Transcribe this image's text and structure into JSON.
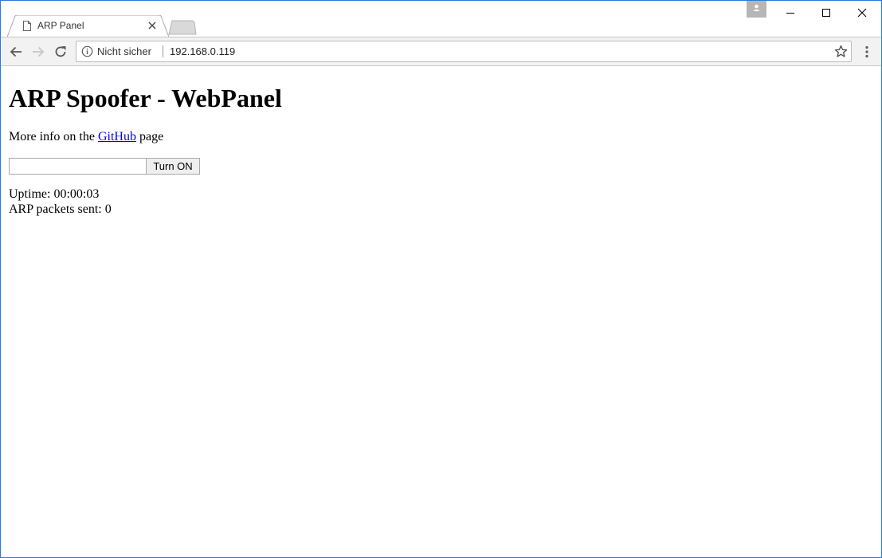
{
  "browser": {
    "tab": {
      "title": "ARP Panel"
    },
    "address_bar": {
      "security_label": "Nicht sicher",
      "url": "192.168.0.119"
    },
    "icons": {
      "tab_page": "page-icon",
      "tab_close": "close-icon",
      "back": "arrow-left-icon",
      "forward": "arrow-right-icon",
      "reload": "reload-icon",
      "info": "info-icon",
      "bookmark": "star-icon",
      "menu": "kebab-menu-icon",
      "profile": "person-icon",
      "minimize": "minimize-icon",
      "maximize": "maximize-icon",
      "close": "close-icon"
    }
  },
  "page": {
    "title": "ARP Spoofer - WebPanel",
    "info_prefix": "More info on the ",
    "info_link": "GitHub",
    "info_suffix": " page",
    "target_input_value": "",
    "turn_on_label": "Turn ON",
    "uptime_label": "Uptime: ",
    "uptime_value": "00:00:03",
    "packets_label": "ARP packets sent: ",
    "packets_value": "0"
  },
  "colors": {
    "window_border": "#2b79d8",
    "link": "#0000ee",
    "toolbar_bg": "#f2f2f2"
  }
}
